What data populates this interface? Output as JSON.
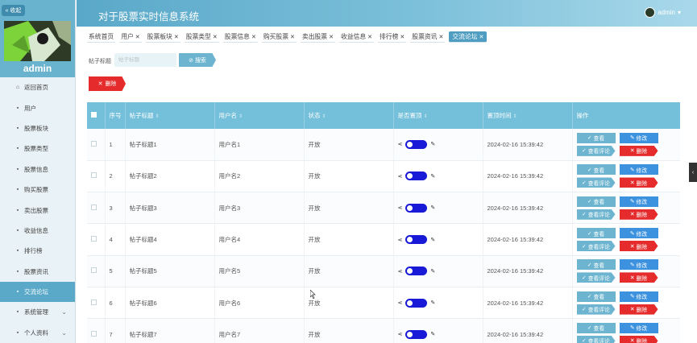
{
  "sidebar": {
    "collapse_label": "« 收起",
    "username": "admin",
    "items": [
      {
        "icon": "⌂",
        "label": "返回首页"
      },
      {
        "icon": "▪",
        "label": "用户"
      },
      {
        "icon": "▪",
        "label": "股票板块"
      },
      {
        "icon": "▪",
        "label": "股票类型"
      },
      {
        "icon": "▪",
        "label": "股票信息"
      },
      {
        "icon": "▪",
        "label": "购买股票"
      },
      {
        "icon": "▪",
        "label": "卖出股票"
      },
      {
        "icon": "▪",
        "label": "收益信息"
      },
      {
        "icon": "▪",
        "label": "排行榜"
      },
      {
        "icon": "▪",
        "label": "股票资讯"
      },
      {
        "icon": "▪",
        "label": "交流论坛"
      },
      {
        "icon": "▪",
        "label": "系统管理"
      },
      {
        "icon": "▪",
        "label": "个人资料"
      }
    ]
  },
  "header": {
    "title": "对于股票实时信息系统",
    "user": "admin"
  },
  "tabs": [
    "系统首页",
    "用户",
    "股票板块",
    "股票类型",
    "股票信息",
    "购买股票",
    "卖出股票",
    "收益信息",
    "排行榜",
    "股票资讯",
    "交流论坛"
  ],
  "search": {
    "label": "帖子标题",
    "placeholder": "帖子标题",
    "button": "搜索"
  },
  "batch_delete": "删除",
  "table": {
    "headers": [
      "序号",
      "帖子标题",
      "用户名",
      "状态",
      "是否置顶",
      "置顶时间",
      "操作"
    ],
    "rows": [
      {
        "no": "1",
        "title": "帖子标题1",
        "user": "用户名1",
        "status": "开放",
        "time": "2024-02-16 15:39:42"
      },
      {
        "no": "2",
        "title": "帖子标题2",
        "user": "用户名2",
        "status": "开放",
        "time": "2024-02-16 15:39:42"
      },
      {
        "no": "3",
        "title": "帖子标题3",
        "user": "用户名3",
        "status": "开放",
        "time": "2024-02-16 15:39:42"
      },
      {
        "no": "4",
        "title": "帖子标题4",
        "user": "用户名4",
        "status": "开放",
        "time": "2024-02-16 15:39:42"
      },
      {
        "no": "5",
        "title": "帖子标题5",
        "user": "用户名5",
        "status": "开放",
        "time": "2024-02-16 15:39:42"
      },
      {
        "no": "6",
        "title": "帖子标题6",
        "user": "用户名6",
        "status": "开放",
        "time": "2024-02-16 15:39:42"
      },
      {
        "no": "7",
        "title": "帖子标题7",
        "user": "用户名7",
        "status": "开放",
        "time": "2024-02-16 15:39:42"
      }
    ],
    "actions": {
      "view": "查看",
      "edit": "修改",
      "comment": "查看评论",
      "delete": "删除"
    }
  },
  "colors": {
    "accent": "#5aa9c9",
    "danger": "#e52b2b",
    "edit": "#3d92e0",
    "switch_on": "#1919d8"
  }
}
